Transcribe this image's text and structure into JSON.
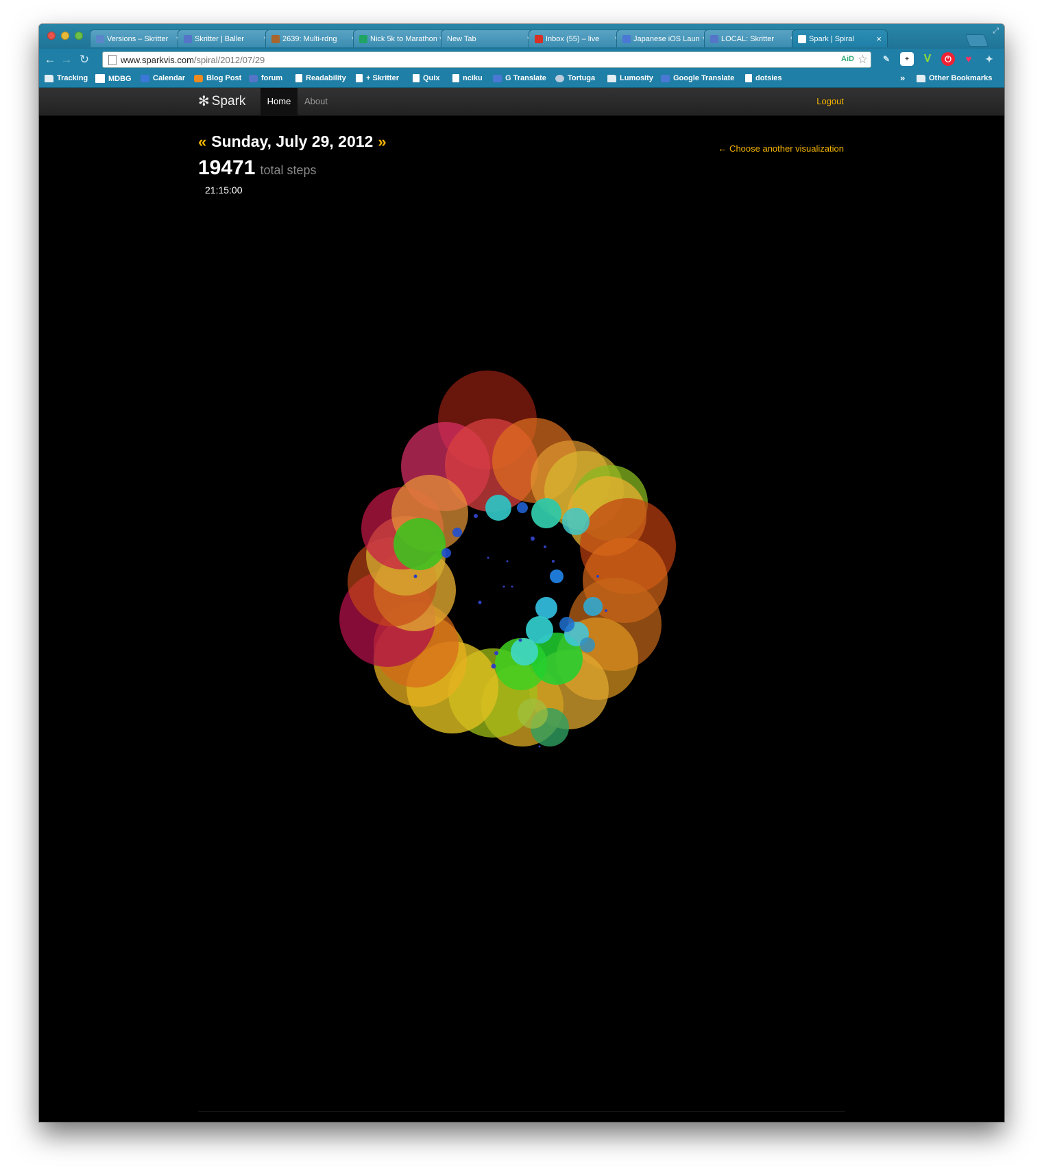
{
  "browser": {
    "tabs": [
      {
        "label": "Versions – Skritter",
        "favicon_color": "#5b86c9",
        "active": false
      },
      {
        "label": "Skritter | Baller",
        "favicon_color": "#5575c8",
        "active": false
      },
      {
        "label": "2639: Multi-rdng",
        "favicon_color": "#a8662c",
        "active": false
      },
      {
        "label": "Nick 5k to Marathon",
        "favicon_color": "#1fa463",
        "active": false
      },
      {
        "label": "New Tab",
        "favicon_color": "",
        "active": false
      },
      {
        "label": "Inbox (55) – live",
        "favicon_color": "#d93025",
        "active": false
      },
      {
        "label": "Japanese iOS Launch",
        "favicon_color": "#4a78d4",
        "active": false
      },
      {
        "label": "LOCAL: Skritter",
        "favicon_color": "#5575c8",
        "active": false
      },
      {
        "label": "Spark | Spiral",
        "favicon_color": "#ffffff",
        "active": true
      }
    ],
    "url_host": "www.sparkvis.com",
    "url_path": "/spiral/2012/07/29",
    "omnibox_ext": "AiD",
    "bookmarks": [
      {
        "label": "Tracking",
        "icon": "folder"
      },
      {
        "label": "MDBG",
        "icon": "mdbg"
      },
      {
        "label": "Calendar",
        "icon": "blue"
      },
      {
        "label": "Blog Post",
        "icon": "orange"
      },
      {
        "label": "forum",
        "icon": "s"
      },
      {
        "label": "Readability",
        "icon": "page"
      },
      {
        "label": "+ Skritter",
        "icon": "page"
      },
      {
        "label": "Quix",
        "icon": "page"
      },
      {
        "label": "nciku",
        "icon": "page"
      },
      {
        "label": "G Translate",
        "icon": "tr"
      },
      {
        "label": "Tortuga",
        "icon": "gray"
      },
      {
        "label": "Lumosity",
        "icon": "folder"
      },
      {
        "label": "Google Translate",
        "icon": "tr"
      },
      {
        "label": "dotsies",
        "icon": "page"
      }
    ],
    "bookmarks_more": "»",
    "other_bookmarks": "Other Bookmarks"
  },
  "site": {
    "brand": "Spark",
    "brand_icon": "asterisk-icon",
    "nav_home": "Home",
    "nav_about": "About",
    "logout": "Logout"
  },
  "page": {
    "prev_arrow": "«",
    "next_arrow": "»",
    "date": "Sunday, July 29, 2012",
    "steps": "19471",
    "steps_label": "total steps",
    "time": "21:15:00",
    "choose_link": "← Choose another visualization"
  },
  "colors": {
    "accent": "#f5b400",
    "background": "#000000"
  }
}
